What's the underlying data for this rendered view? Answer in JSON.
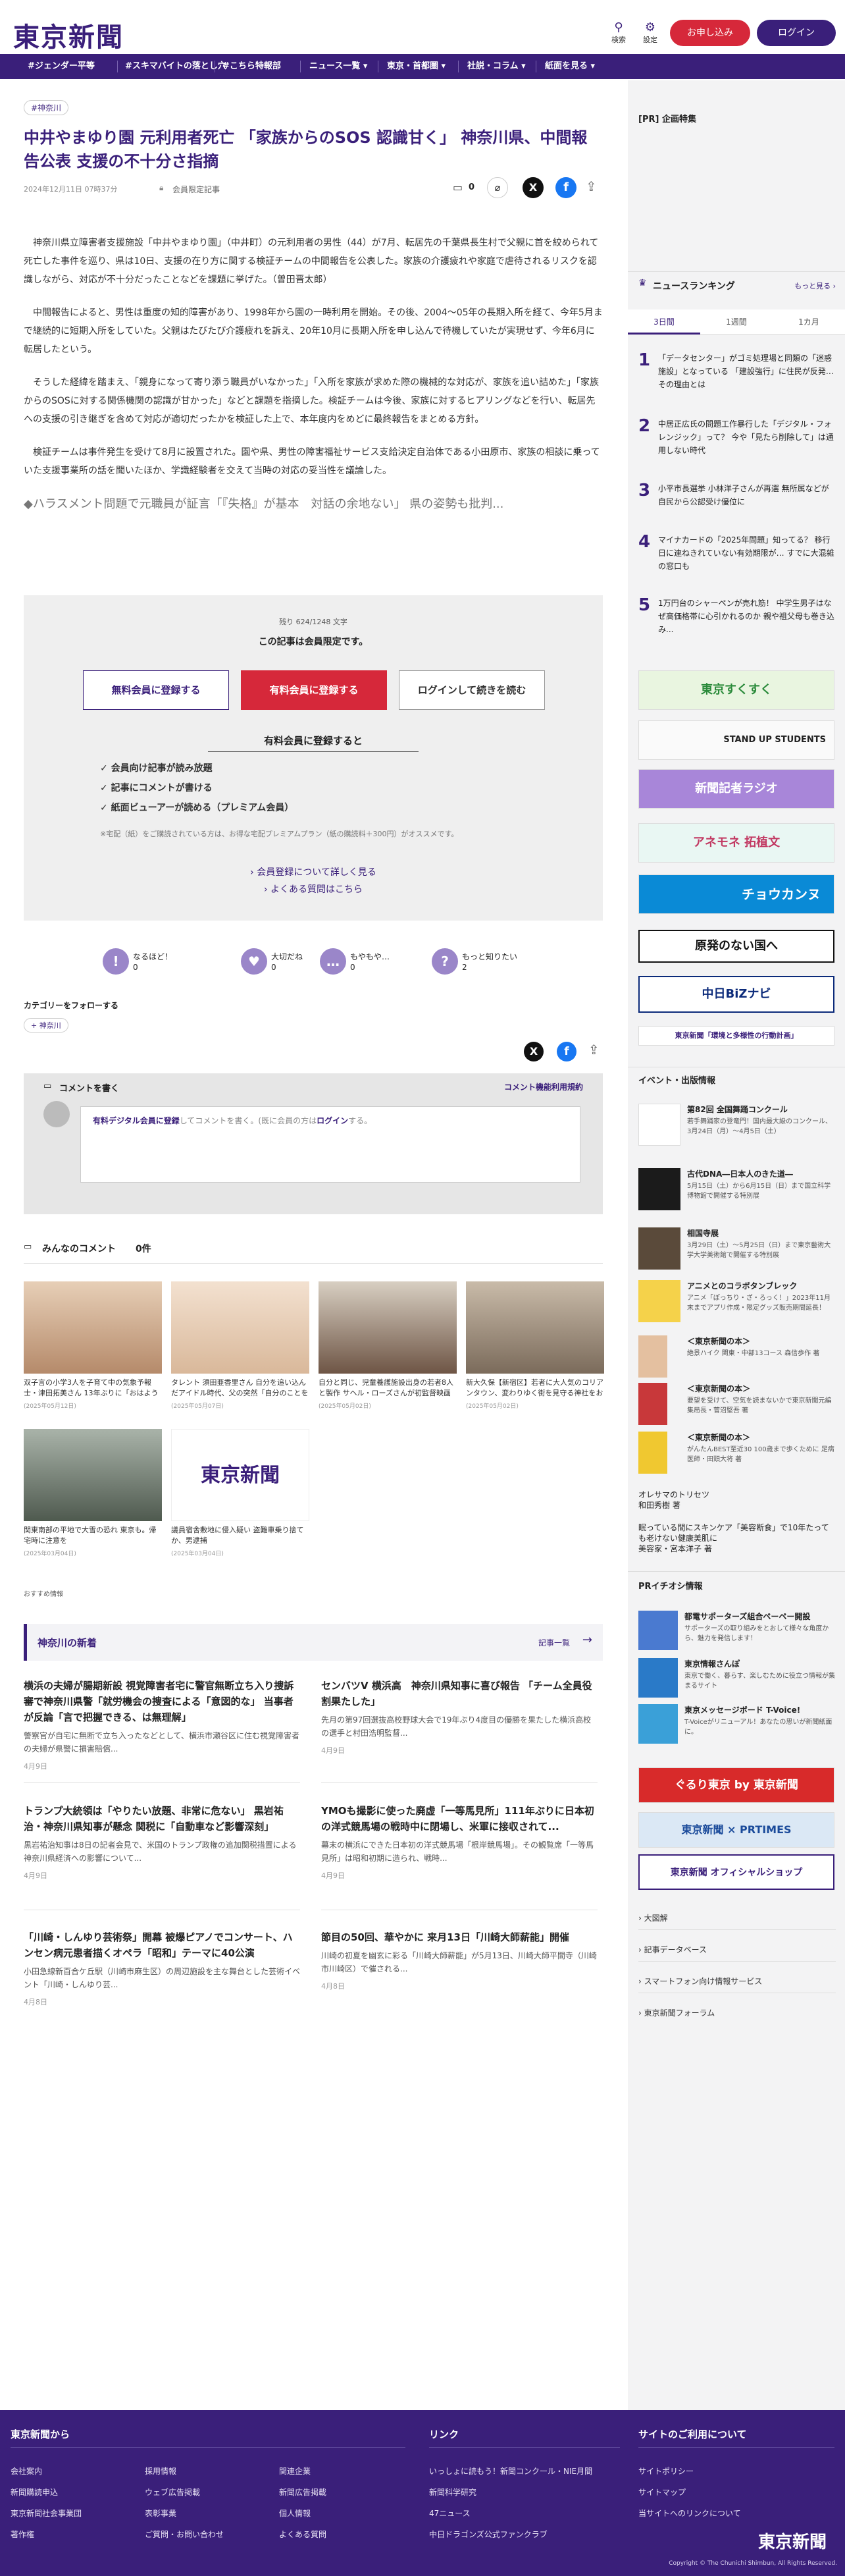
{
  "header": {
    "logo": "東京新聞",
    "search_label": "検索",
    "settings_label": "設定",
    "trial_label": "お申し込み",
    "login_label": "ログイン"
  },
  "nav": {
    "items": [
      "#ジェンダー平等",
      "#スキマバイトの落とし穴",
      "#こちら特報部",
      "ニュース一覧 ▾",
      "東京・首都圏 ▾",
      "社説・コラム ▾",
      "紙面を見る ▾"
    ]
  },
  "article": {
    "tag": "#神奈川",
    "title": "中井やまゆり園 元利用者死亡 「家族からのSOS 認識甘く」 神奈川県、中間報告公表 支援の不十分さ指摘",
    "date": "2024年12月11日 07時37分",
    "member_label": "会員限定記事",
    "comment_count": "0",
    "paragraphs": [
      "神奈川県立障害者支援施設「中井やまゆり園」（中井町）の元利用者の男性（44）が7月、転居先の千葉県長生村で父親に首を絞められて死亡した事件を巡り、県は10日、支援の在り方に関する検証チームの中間報告を公表した。家族の介護疲れや家庭で虐待されるリスクを認識しながら、対応が不十分だったことなどを課題に挙げた。（曽田晋太郎）",
      "中間報告によると、男性は重度の知的障害があり、1998年から園の一時利用を開始。その後、2004〜05年の長期入所を経て、今年5月まで継続的に短期入所をしていた。父親はたびたび介護疲れを訴え、20年10月に長期入所を申し込んで待機していたが実現せず、今年6月に転居したという。",
      "そうした経緯を踏まえ、「親身になって寄り添う職員がいなかった」「入所を家族が求めた際の機械的な対応が、家族を追い詰めた」「家族からのSOSに対する関係機関の認識が甘かった」などと課題を指摘した。検証チームは今後、家族に対するヒアリングなどを行い、転居先への支援の引き継ぎを含めて対応が適切だったかを検証した上で、本年度内をめどに最終報告をまとめる方針。",
      "検証チームは事件発生を受けて8月に設置された。園や県、男性の障害福祉サービス支給決定自治体である小田原市、家族の相談に乗っていた支援事業所の話を聞いたほか、学識経験者を交えて当時の対応の妥当性を議論した。"
    ],
    "related_link": "◆ハラスメント問題で元職員が証言「『失格』が基本　対話の余地ない」 県の姿勢も批判..."
  },
  "paywall": {
    "remaining": "残り 624/1248 文字",
    "notice": "この記事は会員限定です。",
    "free_label": "無料会員に登録する",
    "paid_label": "有料会員に登録する",
    "login_label": "ログインして続きを読む",
    "benefits_title": "有料会員に登録すると",
    "benefits": [
      "会員向け記事が読み放題",
      "記事にコメントが書ける",
      "紙面ビューアーが読める（プレミアム会員）"
    ],
    "note": "※宅配（紙）をご購読されている方は、お得な宅配プレミアムプラン（紙の購読料＋300円）がオススメです。",
    "link1": "会員登録について詳しく見る",
    "link2": "よくある質問はこちら"
  },
  "reactions": [
    {
      "label": "なるほど！",
      "count": "0",
      "glyph": "!"
    },
    {
      "label": "大切だね",
      "count": "0",
      "glyph": "♥"
    },
    {
      "label": "もやもや…",
      "count": "0",
      "glyph": "…"
    },
    {
      "label": "もっと知りたい",
      "count": "2",
      "glyph": "?"
    }
  ],
  "follow": {
    "title": "カテゴリーをフォローする",
    "tag": "神奈川"
  },
  "comment": {
    "heading": "コメントを書く",
    "policy": "コメント機能利用規約",
    "prompt_link": "有料デジタル会員に登録",
    "prompt_mid": "してコメントを書く。(既に会員の方は",
    "prompt_login": "ログイン",
    "prompt_end": "する。",
    "list_heading": "みんなのコメント",
    "list_count": "0件"
  },
  "thumbs": [
    {
      "cap": "双子言の小学3人を子育て中の気象予報士・津田拓美さん 13年ぶりに「おはよう日本」に...",
      "date": "(2025年05月12日)",
      "color": "#d9b28a"
    },
    {
      "cap": "タレント 須田亜香里さん 自分を追い込んだアイドル時代、父の突然「自分のことを好きか？...",
      "date": "(2025年05月07日)",
      "color": "#e7c9b0"
    },
    {
      "cap": "自分と同じ、児童養護施設出身の若者8人と製作 サヘル・ローズさんが初監督映画「花束」...",
      "date": "(2025年05月02日)",
      "color": "#8a6d5a"
    },
    {
      "cap": "新大久保【新宿区】若者に大人気のコリアンタウン、変わりゆく街を見守る神社をお参りし...",
      "date": "(2025年05月02日)",
      "color": "#9c8c7c"
    },
    {
      "cap": "関東南部の平地で大雪の恐れ 東京も。帰宅時に注意を",
      "date": "(2025年03月04日)",
      "color": "#6f7a6f"
    },
    {
      "cap": "議員宿舎敷地に侵入疑い 盗難車乗り捨てか、男逮捕",
      "date": "(2025年03月04日)",
      "color": "#ffffff"
    }
  ],
  "recommend_label": "おすすめ情報",
  "regional": {
    "heading": "神奈川の新着",
    "more": "記事一覧",
    "items": [
      {
        "title": "横浜の夫婦が腸期新設 視覚障害者宅に警官無断立ち入り捜訴審で神奈川県警「就労機会の捜査による「意図的な」 当事者が反論「言で把握できる、は無理解」",
        "ex": "警察官が自宅に無断で立ち入ったなどとして、横浜市瀬谷区に住む視覚障害者の夫婦が県警に損害賠償...",
        "date": "4月9日"
      },
      {
        "title": "センバツV 横浜高　神奈川県知事に喜び報告 「チーム全員役割果たした」",
        "ex": "先月の第97回選抜高校野球大会で19年ぶり4度目の優勝を果たした横浜高校の選手と村田浩明監督...",
        "date": "4月9日"
      },
      {
        "title": "トランプ大統領は「やりたい放題、非常に危ない」 黒岩祐治・神奈川県知事が懸念 関税に「自動車など影響深刻」",
        "ex": "黒岩祐治知事は8日の記者会見で、米国のトランプ政権の追加関税措置による神奈川県経済への影響について...",
        "date": "4月9日"
      },
      {
        "title": "YMOも撮影に使った廃虚「一等馬見所」111年ぶりに日本初の洋式競馬場の戦時中に閉場し、米軍に接収されて...",
        "ex": "幕末の横浜にできた日本初の洋式競馬場「根岸競馬場」。その観覧席「一等馬見所」は昭和初期に造られ、戦時...",
        "date": "4月9日"
      },
      {
        "title": "「川崎・しんゆり芸術祭」開幕 被爆ピアノでコンサート、ハンセン病元患者描くオペラ「昭和」テーマに40公演",
        "ex": "小田急線新百合ケ丘駅（川崎市麻生区）の周辺施設を主な舞台とした芸術イベント「川崎・しんゆり芸...",
        "date": "4月8日"
      },
      {
        "title": "節目の50回、華やかに 来月13日「川崎大師薪能」開催",
        "ex": "川崎の初夏を幽玄に彩る「川崎大師薪能」が5月13日、川崎大師平間寺（川崎市川崎区）で催される...",
        "date": "4月8日"
      }
    ]
  },
  "sidebar": {
    "pr_label": "[PR] 企画特集",
    "ranking_title": "ニュースランキング",
    "ranking_more": "もっと見る",
    "tabs": [
      "3日間",
      "1週間",
      "1カ月"
    ],
    "ranking": [
      {
        "num": "1",
        "text": "「データセンター」がゴミ処理場と同類の「迷惑施設」となっている 「建設強行」に住民が反発…その理由とは"
      },
      {
        "num": "2",
        "text": "中居正広氏の問題工作暴行した「デジタル・フォレンジック」って？ 今や「見たら削除して」は通用しない時代"
      },
      {
        "num": "3",
        "text": "小平市長選挙 小林洋子さんが再選 無所属などが自民から公認受け優位に"
      },
      {
        "num": "4",
        "text": "マイナカードの「2025年問題」知ってる？ 移行日に連ねきれていない有効期限が… すでに大混雑の窓口も"
      },
      {
        "num": "5",
        "text": "1万円台のシャーペンが売れ筋！ 中学生男子はなぜ高価格帯に心引かれるのか 親や祖父母も巻き込み..."
      }
    ],
    "banners": [
      {
        "text": "東京すくすく",
        "bg": "#e9f5e0",
        "fg": "#2a8a3a"
      },
      {
        "text": "STAND UP STUDENTS",
        "bg": "#fafafa",
        "fg": "#222"
      },
      {
        "text": "新聞記者ラジオ",
        "bg": "#a886d9",
        "fg": "#fff"
      },
      {
        "text": "アネモネ 拓植文",
        "bg": "#e9f7f3",
        "fg": "#c23a63"
      },
      {
        "text": "チョウカンヌ",
        "bg": "#0a8ad6",
        "fg": "#fff"
      },
      {
        "text": "原発のない国へ",
        "bg": "#ffffff",
        "fg": "#111"
      },
      {
        "text": "中日BiZナビ",
        "bg": "#ffffff",
        "fg": "#0b2a7a"
      },
      {
        "text": "東京新聞「環境と多様性の行動計画」",
        "bg": "#ffffff",
        "fg": "#3a1f7a"
      }
    ],
    "event_title": "イベント・出版情報",
    "events": [
      {
        "t": "第82回 全国舞踊コンクール",
        "d": "若手舞踊家の登竜門！国内最大級のコンクール、3月24日（月）〜4月5日（土）",
        "c": "#ffffff"
      },
      {
        "t": "古代DNA―日本人のきた道―",
        "d": "5月15日（土）から6月15日（日）まで国立科学博物館で開催する特別展",
        "c": "#1b1b1b"
      },
      {
        "t": "相国寺展",
        "d": "3月29日（土）〜5月25日（日）まで東京藝術大学大学美術館で開催する特別展",
        "c": "#5a4a3a"
      },
      {
        "t": "アニメとのコラボタンブレック",
        "d": "アニメ「ぽっちり・ざ・ろっく！」2023年11月末までアプリ作成・限定グッズ販売期間延長！",
        "c": "#f5d24a"
      },
      {
        "t": "＜東京新聞の本＞",
        "d": "絶景ハイク 関東・中部13コース 森信歩作 著",
        "c": "#e4c0a0"
      },
      {
        "t": "＜東京新聞の本＞",
        "d": "要望を受けて、空気を読まないかで東京新聞元編集局長・菅沼堅吾 著",
        "c": "#c8383a"
      },
      {
        "t": "＜東京新聞の本＞",
        "d": "がんたんBEST至近30 100歳まで歩くために 足病医師・田頭大将 著",
        "c": "#f0c830"
      }
    ],
    "book_lines": [
      "オレサマのトリセツ",
      "和田秀樹 著",
      "眠っている間にスキンケア「美容断食」で10年たっても老けない健康美肌に",
      "美容家・宮本洋子 著"
    ],
    "pr_title": "PRイチオシ情報",
    "prs": [
      {
        "t": "都電サポーターズ組合ペーペー開設",
        "d": "サポーターズの取り組みをとおして様々な角度から、魅力を発信します！",
        "c": "#4a7ad0"
      },
      {
        "t": "東京情報さんぽ",
        "d": "東京で働く、暮らす、楽しむために役立つ情報が集まるサイト",
        "c": "#2a7ac8"
      },
      {
        "t": "東京メッセージボード T-Voice!",
        "d": "T-Voiceがリニューアル！あなたの思いが新聞紙面に。",
        "c": "#3aa0d8"
      }
    ],
    "banners2": [
      {
        "text": "ぐるり東京 by 東京新聞",
        "bg": "#d82a2a",
        "fg": "#fff"
      },
      {
        "text": "東京新聞 × PRTIMES",
        "bg": "#dbe8f5",
        "fg": "#1a4a9a"
      },
      {
        "text": "東京新聞 オフィシャルショップ",
        "bg": "#ffffff",
        "fg": "#3a1f7a"
      }
    ],
    "links": [
      "大図解",
      "記事データベース",
      "スマートフォン向け情報サービス",
      "東京新聞フォーラム"
    ]
  },
  "footer": {
    "col1_title": "東京新聞から",
    "col1": [
      "会社案内",
      "新聞購読申込",
      "東京新聞社会事業団",
      "著作権",
      "採用情報",
      "ウェブ広告掲載",
      "表彰事業",
      "ご質問・お問い合わせ",
      "関連企業",
      "新聞広告掲載",
      "個人情報",
      "よくある質問"
    ],
    "col2_title": "リンク",
    "col2": [
      "いっしょに読もう！新聞コンクール・NIE月間",
      "新聞科学研究",
      "47ニュース",
      "中日ドラゴンズ公式ファンクラブ"
    ],
    "col3_title": "サイトのご利用について",
    "col3": [
      "サイトポリシー",
      "サイトマップ",
      "当サイトへのリンクについて"
    ],
    "logo": "東京新聞",
    "copyright": "Copyright © The Chunichi Shimbun, All Rights Reserved."
  }
}
